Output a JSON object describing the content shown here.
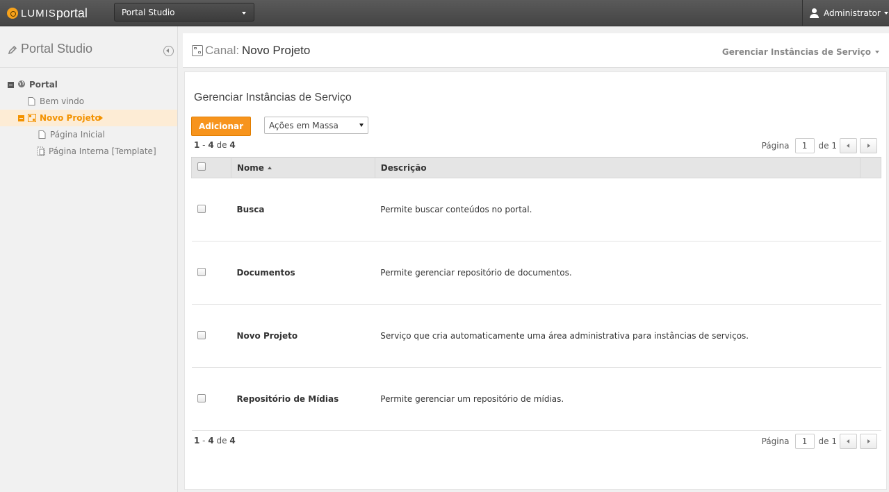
{
  "topbar": {
    "logo_lumis": "LUMIS",
    "logo_portal": "portal",
    "portal_select": "Portal Studio",
    "user": "Administrator"
  },
  "sidebar": {
    "title": "Portal Studio",
    "tree": [
      {
        "label": "Portal",
        "icon": "globe-icon",
        "toggle": true
      },
      {
        "label": "Bem vindo",
        "icon": "page-icon"
      },
      {
        "label": "Novo Projeto",
        "icon": "channel-icon",
        "toggle": true,
        "selected": true
      },
      {
        "label": "Página Inicial",
        "icon": "page-icon"
      },
      {
        "label": "Página Interna [Template]",
        "icon": "template-page-icon"
      }
    ]
  },
  "header": {
    "channel_prefix": "Canal:",
    "channel_name": "Novo Projeto",
    "manage_link": "Gerenciar Instâncias de Serviço"
  },
  "content": {
    "title": "Gerenciar Instâncias de Serviço",
    "add_button": "Adicionar",
    "bulk_actions": "Ações em Massa",
    "count": {
      "from": "1",
      "to": "4",
      "of_label": "de",
      "total": "4"
    },
    "pager": {
      "label": "Página",
      "page": "1",
      "of_label": "de",
      "total": "1"
    },
    "columns": {
      "name": "Nome",
      "description": "Descrição"
    },
    "rows": [
      {
        "name": "Busca",
        "description": "Permite buscar conteúdos no portal."
      },
      {
        "name": "Documentos",
        "description": "Permite gerenciar repositório de documentos."
      },
      {
        "name": "Novo Projeto",
        "description": "Serviço que cria automaticamente uma área administrativa para instâncias de serviços."
      },
      {
        "name": "Repositório de Mídias",
        "description": "Permite gerenciar um repositório de mídias."
      }
    ]
  },
  "colors": {
    "accent": "#f7941d",
    "topbar": "#4a4a4a",
    "selected_bg": "#fdecd5"
  }
}
